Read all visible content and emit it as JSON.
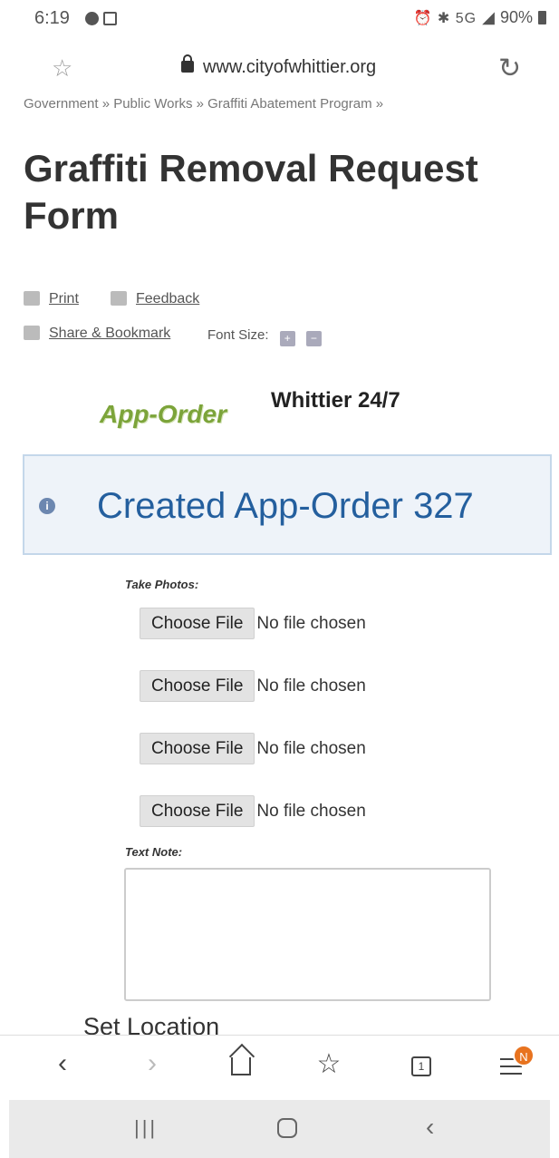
{
  "status_bar": {
    "time": "6:19",
    "system_icons": "⏰ ✱ 5G",
    "battery": "90%"
  },
  "url_bar": {
    "url": "www.cityofwhittier.org"
  },
  "breadcrumb": "Government » Public Works » Graffiti Abatement Program »",
  "page": {
    "title": "Graffiti Removal Request Form"
  },
  "tools": {
    "print": "Print",
    "feedback": "Feedback",
    "share": "Share & Bookmark",
    "font_size": "Font Size:"
  },
  "logo": {
    "text": "App-Order",
    "subtitle": "Whittier 24/7"
  },
  "notice": {
    "text": "Created App-Order 327"
  },
  "form": {
    "photos_label": "Take Photos:",
    "file_inputs": [
      {
        "button": "Choose File",
        "status": "No file chosen"
      },
      {
        "button": "Choose File",
        "status": "No file chosen"
      },
      {
        "button": "Choose File",
        "status": "No file chosen"
      },
      {
        "button": "Choose File",
        "status": "No file chosen"
      }
    ],
    "note_label": "Text Note:",
    "note_value": "",
    "location_label": "Set Location"
  },
  "browser_nav": {
    "tabs_count": "1",
    "menu_badge": "N"
  },
  "icons": {
    "colors": {
      "accent": "#245f9e",
      "notice_bg": "#eef3f9",
      "logo_green": "#7ca43a",
      "badge": "#e8731f"
    }
  }
}
